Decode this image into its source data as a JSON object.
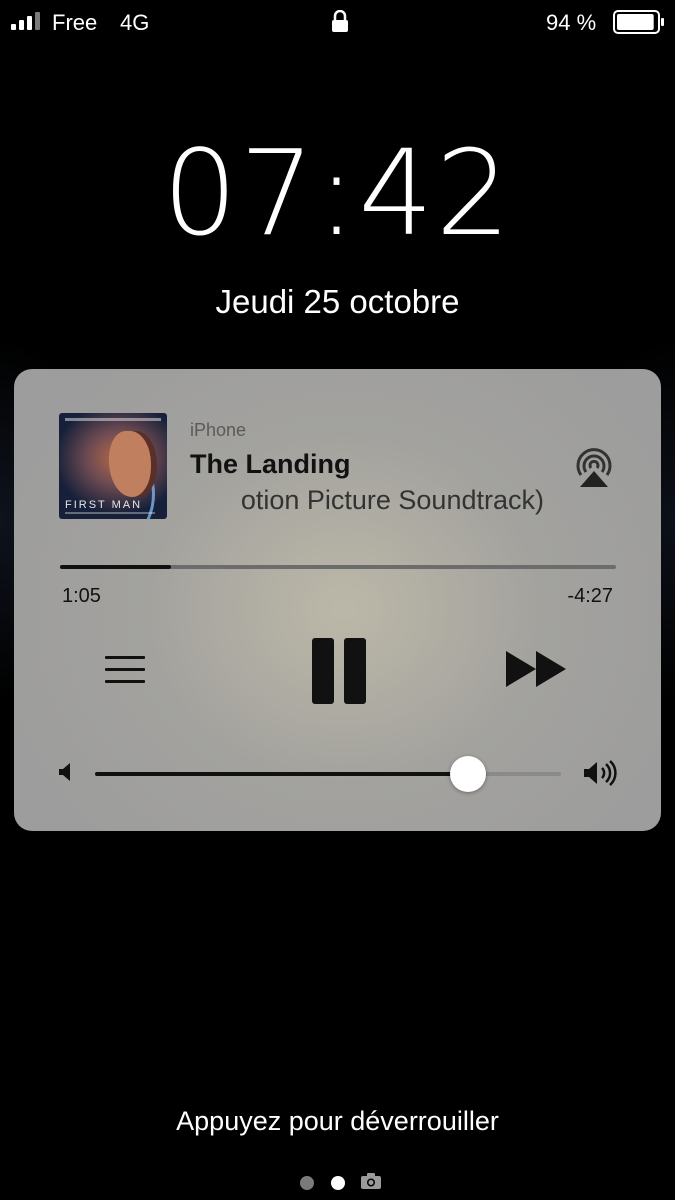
{
  "status_bar": {
    "carrier": "Free",
    "network": "4G",
    "battery_percent": "94 %",
    "battery_level": 0.94,
    "signal_bars_active": 3,
    "signal_bars_total": 4
  },
  "lock_screen": {
    "time": "07:42",
    "date": "Jeudi 25 octobre",
    "unlock_hint": "Appuyez pour déverrouiller",
    "pages": {
      "count": 2,
      "current": 1
    }
  },
  "now_playing": {
    "source": "iPhone",
    "title": "The Landing",
    "subtitle": "otion Picture Soundtrack)",
    "album_art_title": "FIRST MAN",
    "elapsed": "1:05",
    "remaining": "-4:27",
    "progress": 0.2,
    "volume": 0.8
  },
  "icons": {
    "lock": "padlock-icon",
    "airplay": "airplay-icon",
    "menu": "list-icon",
    "pause": "pause-icon",
    "next": "fast-forward-icon",
    "volume_min": "speaker-min-icon",
    "volume_max": "speaker-max-icon",
    "camera": "camera-icon"
  },
  "colors": {
    "background": "#000000",
    "card": "#a3a29e",
    "controls": "#111111",
    "text_light": "#ffffff"
  }
}
